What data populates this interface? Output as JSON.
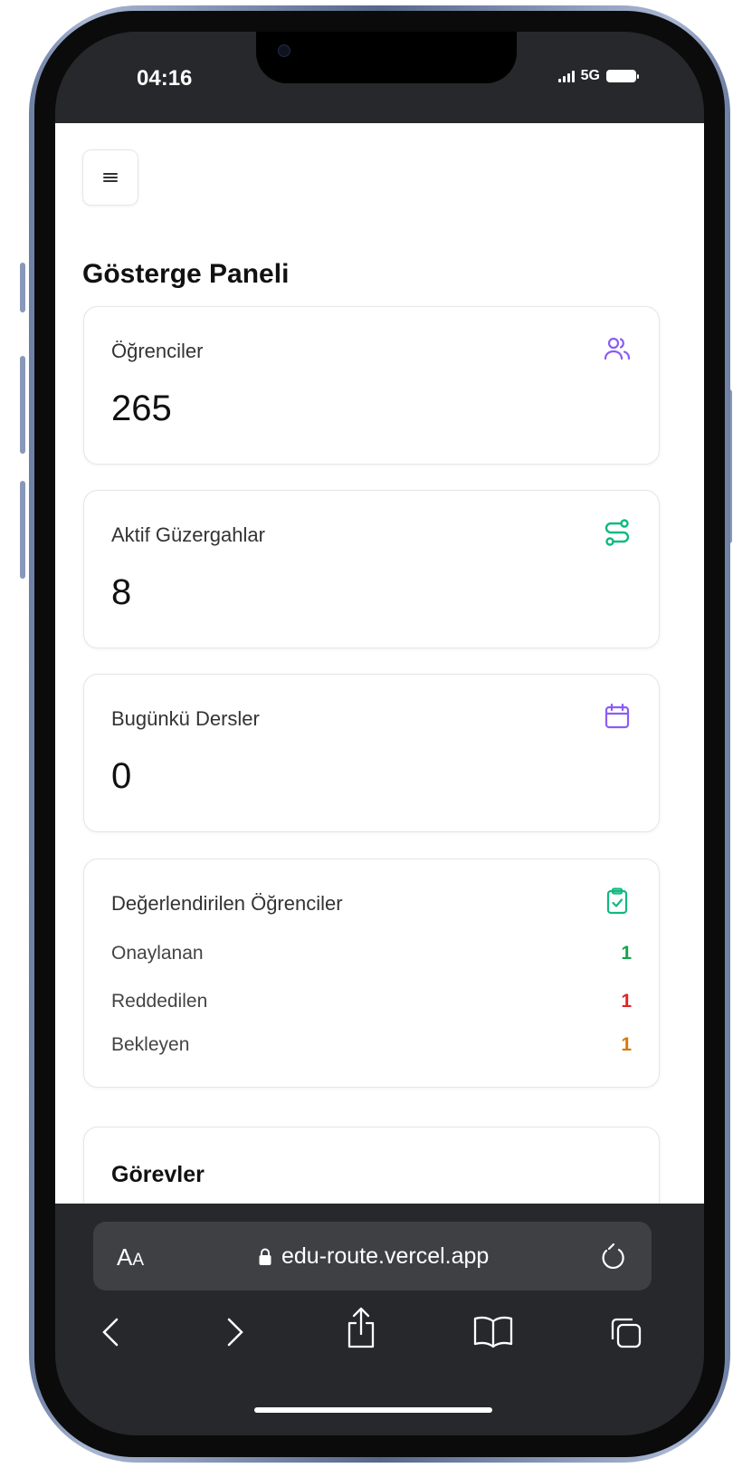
{
  "status_bar": {
    "time": "04:16",
    "network": "5G"
  },
  "header": {
    "menu_icon": "hamburger-icon"
  },
  "page": {
    "title": "Gösterge Paneli"
  },
  "cards": {
    "students": {
      "title": "Öğrenciler",
      "value": "265",
      "icon": "users-icon",
      "icon_color": "#8b5cf6"
    },
    "routes": {
      "title": "Aktif Güzergahlar",
      "value": "8",
      "icon": "route-icon",
      "icon_color": "#10b981"
    },
    "lessons": {
      "title": "Bugünkü Dersler",
      "value": "0",
      "icon": "calendar-icon",
      "icon_color": "#8b5cf6"
    },
    "evaluated": {
      "title": "Değerlendirilen Öğrenciler",
      "icon": "clipboard-check-icon",
      "icon_color": "#10b981",
      "rows": [
        {
          "label": "Onaylanan",
          "value": "1",
          "color": "#16a34a"
        },
        {
          "label": "Reddedilen",
          "value": "1",
          "color": "#dc2626"
        },
        {
          "label": "Bekleyen",
          "value": "1",
          "color": "#d97706"
        }
      ]
    },
    "tasks": {
      "title": "Görevler"
    }
  },
  "browser": {
    "text_size_label": "AA",
    "url": "edu-route.vercel.app",
    "nav": [
      "back-icon",
      "forward-icon",
      "share-icon",
      "bookmarks-icon",
      "tabs-icon"
    ]
  }
}
